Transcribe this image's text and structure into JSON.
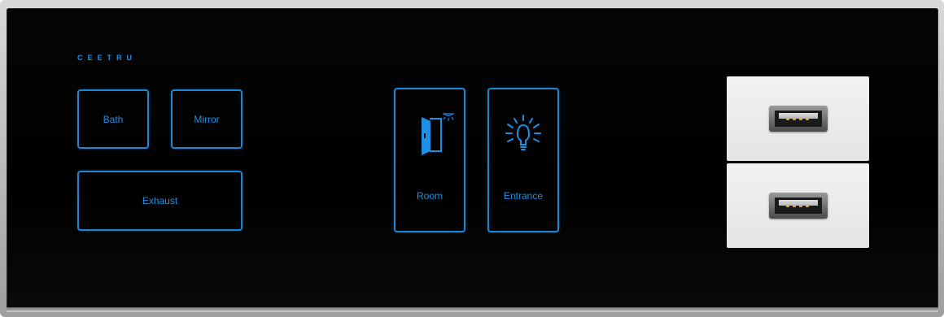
{
  "brand": "CEETRU",
  "keys": {
    "bath": "Bath",
    "mirror": "Mirror",
    "exhaust": "Exhaust",
    "room": "Room",
    "entrance": "Entrance"
  },
  "icons": {
    "room": "door-with-light-icon",
    "entrance": "light-bulb-icon"
  },
  "usb_ports": [
    "usb-a-port",
    "usb-a-port"
  ],
  "colors": {
    "accent": "#1e90e4",
    "panel": "#000000",
    "frame": "#c4c4c4",
    "usb_module": "#ececec"
  }
}
